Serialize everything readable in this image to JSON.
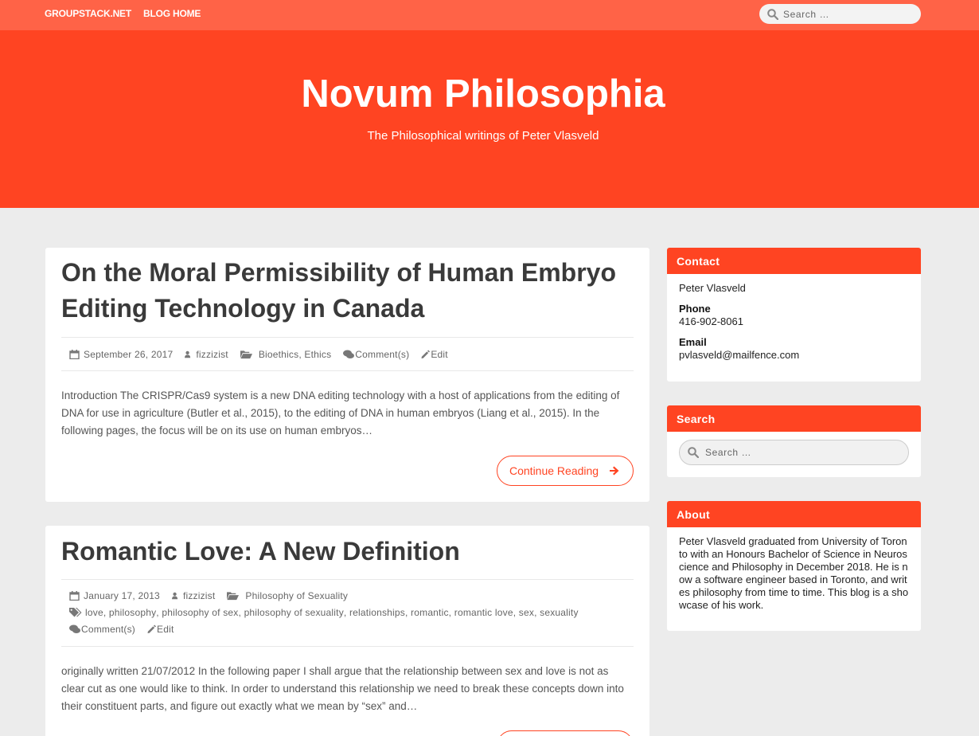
{
  "topnav": {
    "item1": "GROUPSTACK.NET",
    "item2": "BLOG HOME",
    "search_placeholder": "Search …"
  },
  "header": {
    "title": "Novum Philosophia",
    "tagline": "The Philosophical writings of Peter Vlasveld"
  },
  "posts": [
    {
      "title": "On the Moral Permissibility of Human Embryo Editing Technology in Canada",
      "date": "September 26, 2017",
      "author": "fizzizist",
      "cat1": "Bioethics",
      "cat2": "Ethics",
      "comments": "Comment(s)",
      "edit": "Edit",
      "excerpt": "Introduction      The CRISPR/Cas9 system is a new DNA editing technology with a host of applications from the editing of DNA for use in agriculture (Butler et al., 2015), to the editing of DNA in human embryos (Liang et al., 2015). In the following pages, the focus will be on its use on human embryos…",
      "continue": "Continue Reading"
    },
    {
      "title": "Romantic Love: A New Definition",
      "date": "January 17, 2013",
      "author": "fizzizist",
      "category": "Philosophy of Sexuality",
      "tags": [
        "love",
        "philosophy",
        "philosophy of sex",
        "philosophy of sexuality",
        "relationships",
        "romantic",
        "romantic love",
        "sex",
        "sexuality"
      ],
      "comments": "Comment(s)",
      "edit": "Edit",
      "excerpt": "originally written 21/07/2012   In the following paper I shall argue that the relationship between sex and love is not as clear cut as one would like to think. In order to understand this relationship we need to break these concepts down into their constituent parts, and figure out exactly what we mean by “sex” and…"
    }
  ],
  "sidebar": {
    "contact": {
      "heading": "Contact",
      "name": "Peter Vlasveld",
      "phone_label": "Phone",
      "phone": "416-902-8061",
      "email_label": "Email",
      "email": "pvlasveld@mailfence.com"
    },
    "search": {
      "heading": "Search",
      "placeholder": "Search …"
    },
    "about": {
      "heading": "About",
      "text": "Peter Vlasveld graduated from University of Toronto with an Honours Bachelor of Science in Neuroscience and Philosophy in December 2018. He is now a software engineer based in Toronto, and writes philosophy from time to time. This blog is a showcase of his work."
    }
  },
  "colors": {
    "topbar": "#ff6347",
    "accent": "#ff4422",
    "background": "#ececec"
  }
}
